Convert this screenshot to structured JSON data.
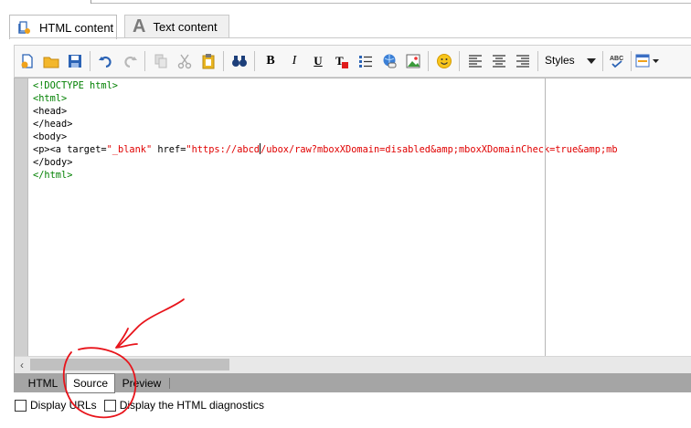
{
  "tabs": [
    {
      "label": "HTML content",
      "icon": "html-content-icon",
      "active": true
    },
    {
      "label": "Text content",
      "icon": "text-content-icon",
      "active": false
    }
  ],
  "toolbar": {
    "styles_label": "Styles"
  },
  "code_lines": [
    {
      "parts": [
        {
          "t": "<!DOCTYPE html>",
          "c": "kw"
        }
      ]
    },
    {
      "parts": [
        {
          "t": "<html>",
          "c": "kw"
        }
      ]
    },
    {
      "parts": [
        {
          "t": "<head>",
          "c": "nm"
        }
      ]
    },
    {
      "parts": [
        {
          "t": "</head>",
          "c": "nm"
        }
      ]
    },
    {
      "parts": [
        {
          "t": "<body>",
          "c": "nm"
        }
      ]
    },
    {
      "parts": [
        {
          "t": "<p><a target=",
          "c": "nm"
        },
        {
          "t": "\"_blank\"",
          "c": "str"
        },
        {
          "t": " href=",
          "c": "nm"
        },
        {
          "t": "\"https://abcd",
          "c": "str"
        },
        {
          "t": "|",
          "c": "caret"
        },
        {
          "t": "/ubox/raw?mboxXDomain=disabled&amp;mboxXDomainCheck=true&amp;mb",
          "c": "str"
        }
      ]
    },
    {
      "parts": [
        {
          "t": "</body>",
          "c": "nm"
        }
      ]
    },
    {
      "parts": [
        {
          "t": "</html>",
          "c": "kw"
        }
      ]
    }
  ],
  "bottom_tabs": [
    {
      "label": "HTML",
      "active": false
    },
    {
      "label": "Source",
      "active": true
    },
    {
      "label": "Preview",
      "active": false
    }
  ],
  "options": {
    "display_urls": "Display URLs",
    "display_diagnostics": "Display the HTML diagnostics"
  },
  "colors": {
    "annotation": "#e8141b",
    "tag_green": "#008000",
    "string_red": "#e00000"
  }
}
